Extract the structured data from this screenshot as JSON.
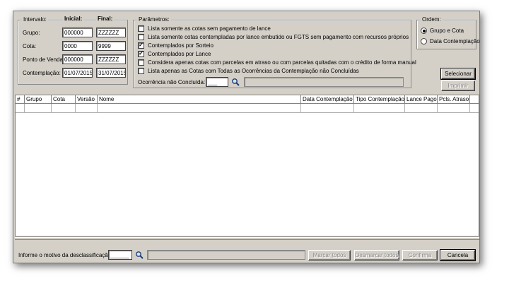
{
  "intervalo": {
    "title": "Intervalo:",
    "header_inicial": "Inicial:",
    "header_final": "Final:",
    "rows": [
      {
        "label": "Grupo:",
        "inicial": "000000",
        "final": "ZZZZZZ"
      },
      {
        "label": "Cota:",
        "inicial": "0000",
        "final": "9999"
      },
      {
        "label": "Ponto de Venda:",
        "inicial": "000000",
        "final": "ZZZZZZ"
      },
      {
        "label": "Contemplação:",
        "inicial": "01/07/2015",
        "final": "31/07/2015"
      }
    ]
  },
  "parametros": {
    "title": "Parâmetros:",
    "options": [
      {
        "label": "Lista somente as cotas sem pagamento de lance",
        "checked": false
      },
      {
        "label": "Lista somente cotas contempladas por lance embutido ou FGTS sem pagamento com recursos próprios",
        "checked": false
      },
      {
        "label": "Contemplados por Sorteio",
        "checked": true
      },
      {
        "label": "Contemplados por Lance",
        "checked": true
      },
      {
        "label": "Considera apenas cotas com parcelas em atraso ou com parcelas quitadas com o crédito de forma manual",
        "checked": false
      },
      {
        "label": "Lista apenas as Cotas com Todas as Ocorrências da Contemplação não Concluídas",
        "checked": false
      }
    ],
    "ocorrencia_label": "Ocorrência não Concluída:",
    "ocorrencia_value": "___"
  },
  "ordem": {
    "title": "Ordem:",
    "options": [
      {
        "label": "Grupo e Cota",
        "selected": true
      },
      {
        "label": "Data Contemplação",
        "selected": false
      }
    ]
  },
  "actions": {
    "selecionar": "Selecionar",
    "imprimir": "Imprimir"
  },
  "grid": {
    "columns": [
      "#",
      "Grupo",
      "Cota",
      "Versão",
      "Nome",
      "Data Contemplação",
      "Tipo Contemplação",
      "Lance Pago",
      "Pcls. Atraso"
    ]
  },
  "footer": {
    "motivo_label": "Informe o motivo da desclassificação:",
    "motivo_value": "______",
    "marcar_todos": "Marcar todos",
    "desmarcar_todos": "Desmarcar todos",
    "confirma": "Confirma",
    "cancela": "Cancela"
  },
  "colors": {
    "window_bg": "#d4d0c8",
    "field_bg": "#ffffff",
    "disabled_text": "#8a8a8a"
  },
  "icons": {
    "search": "magnifier-icon",
    "check": "checkmark-icon"
  }
}
